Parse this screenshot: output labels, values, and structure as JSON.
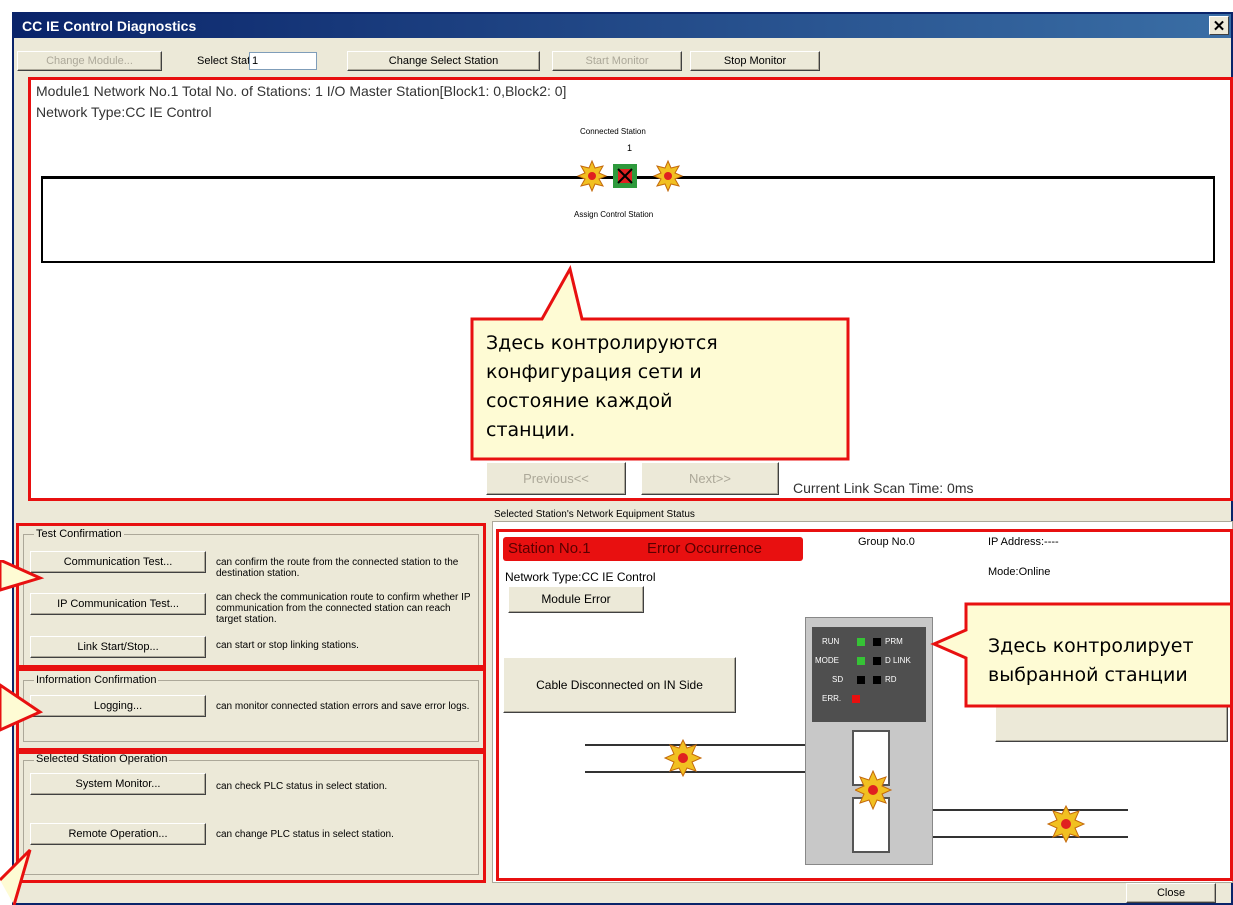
{
  "window": {
    "title": "CC IE Control Diagnostics",
    "close_glyph": "✕"
  },
  "toolbar": {
    "change_module": "Change Module...",
    "select_station_label": "Select Station",
    "select_station_value": "1",
    "change_select_station": "Change Select Station",
    "start_monitor": "Start Monitor",
    "stop_monitor": "Stop Monitor"
  },
  "network": {
    "info_line": "Module1  Network No.1  Total No. of Stations:  1  I/O Master Station[Block1:  0,Block2:  0]",
    "type_line": "Network Type:CC IE Control",
    "connected_station": "Connected Station",
    "station_number": "1",
    "assign_control_station": "Assign Control Station",
    "previous": "Previous<<",
    "next": "Next>>",
    "link_scan_time": "Current Link Scan Time:    0ms"
  },
  "callout_top": {
    "lines": [
      "Здесь контролируются",
      "конфигурация сети и",
      "состояние каждой",
      "станции."
    ]
  },
  "test_confirmation": {
    "title": "Test Confirmation",
    "comm_test": "Communication Test...",
    "comm_test_desc": "can confirm the route from the connected station to the destination station.",
    "ip_test": "IP Communication Test...",
    "ip_test_desc": "can check the communication route to confirm whether IP communication from the connected station can reach target station.",
    "link": "Link Start/Stop...",
    "link_desc": "can start or stop linking stations."
  },
  "information_confirmation": {
    "title": "Information Confirmation",
    "logging": "Logging...",
    "logging_desc": "can monitor connected station errors and save error logs."
  },
  "selected_station_operation": {
    "title": "Selected Station Operation",
    "system_monitor": "System Monitor...",
    "system_monitor_desc": "can check PLC status in select station.",
    "remote_operation": "Remote Operation...",
    "remote_operation_desc": "can change PLC status in select station."
  },
  "station_status": {
    "section_title": "Selected Station's Network Equipment Status",
    "station_label": "Station No.1",
    "error_label": "Error Occurrence",
    "group": "Group No.0",
    "ip": "IP Address:----",
    "network_type": "Network Type:CC IE Control",
    "mode": "Mode:Online",
    "module_error": "Module Error",
    "cable": "Cable Disconnected on IN Side",
    "leds": [
      "RUN",
      "PRM",
      "MODE",
      "D LINK",
      "SD",
      "RD",
      "ERR."
    ],
    "accent_red": "#e81010",
    "led_green": "#36c236"
  },
  "callout_right": {
    "lines": [
      "Здесь контролирует",
      "выбранной станции"
    ]
  },
  "close_button": "Close"
}
